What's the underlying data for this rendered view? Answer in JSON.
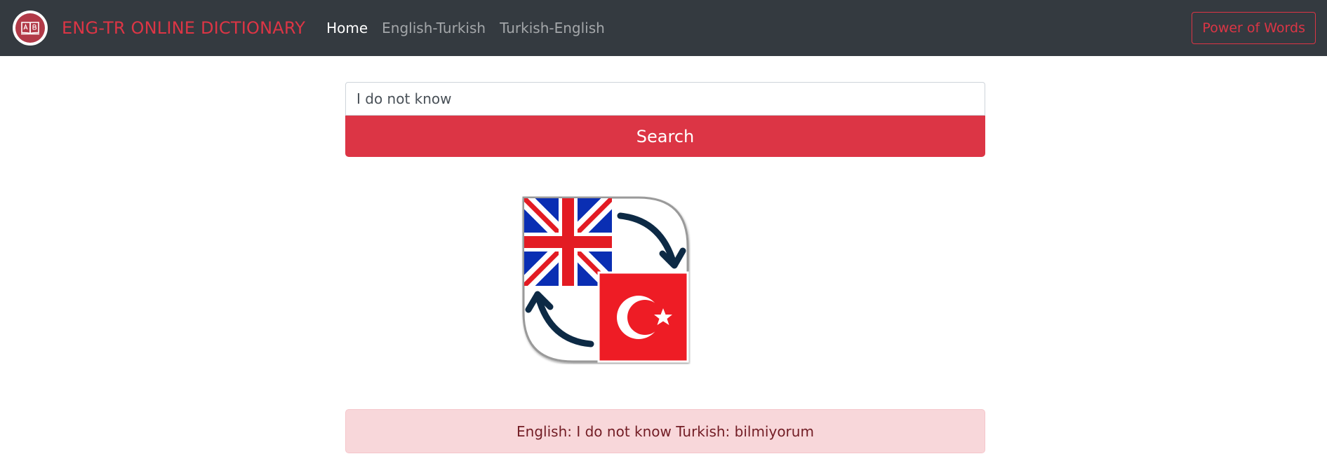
{
  "navbar": {
    "brand": "ENG-TR ONLINE DICTIONARY",
    "logo_icon": "dictionary-book-icon",
    "links": [
      {
        "label": "Home",
        "active": true
      },
      {
        "label": "English-Turkish",
        "active": false
      },
      {
        "label": "Turkish-English",
        "active": false
      }
    ],
    "cta_label": "Power of Words"
  },
  "search": {
    "value": "I do not know",
    "button_label": "Search"
  },
  "illustration": {
    "icon": "english-turkish-translate-flags-icon"
  },
  "result": {
    "text": "English: I do not know Turkish: bilmiyorum"
  },
  "colors": {
    "navbar_bg": "#343a40",
    "accent": "#dc3545",
    "alert_bg": "#f8d7da",
    "alert_text": "#721c24"
  }
}
